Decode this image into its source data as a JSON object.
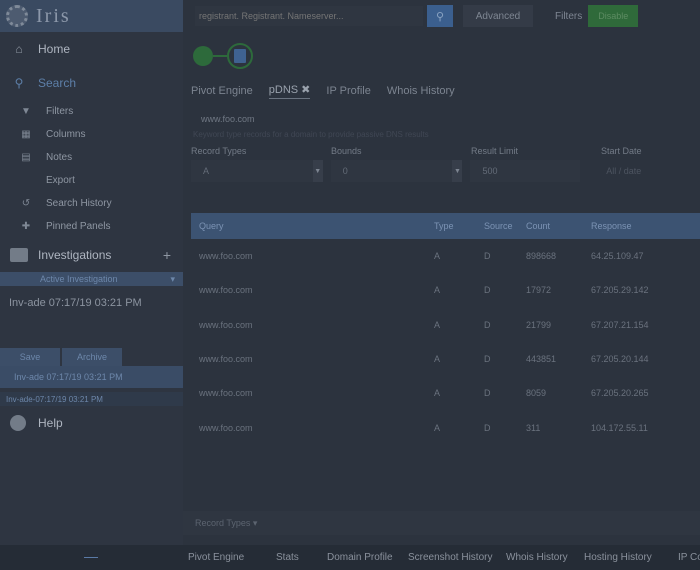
{
  "app": {
    "logo_text": "Iris"
  },
  "sidebar": {
    "main_items": [
      {
        "label": "Home",
        "icon": "home-icon"
      },
      {
        "label": "Search",
        "icon": "search-icon"
      }
    ],
    "search_sub_items": [
      {
        "label": "Filters",
        "icon": "filter-icon"
      },
      {
        "label": "Columns",
        "icon": "columns-icon"
      },
      {
        "label": "Notes",
        "icon": "notes-icon"
      },
      {
        "label": "Export",
        "icon": ""
      },
      {
        "label": "Search History",
        "icon": "history-icon"
      },
      {
        "label": "Pinned Panels",
        "icon": "pin-icon"
      }
    ],
    "investigations_label": "Investigations",
    "active_investigation": "Active Investigation",
    "investigation_title": "Inv-ade 07:17/19 03:21 PM",
    "tabs": [
      "Save",
      "Archive"
    ],
    "selected_item": "Inv-ade 07:17/19 03:21 PM",
    "investigation_item": "Inv-ade-07:17/19 03:21 PM",
    "help_label": "Help"
  },
  "topbar": {
    "search_placeholder": "registrant. Registrant. Nameserver...",
    "advanced_label": "Advanced",
    "filters_label": "Filters",
    "filters_button": "Disable"
  },
  "tabs": [
    "Pivot Engine",
    "pDNS",
    "IP Profile",
    "Whois History"
  ],
  "active_tab": "pDNS",
  "query_value": "www.foo.com",
  "hint_text": "Keyword type records for a domain to provide passive DNS results",
  "form": {
    "labels": [
      "Record Types",
      "Bounds",
      "Result Limit",
      "Start Date"
    ],
    "record_type": "A",
    "bounds": "0",
    "result_limit": "500",
    "start_date": "All / date"
  },
  "table": {
    "headers": [
      "Query",
      "Type",
      "Source",
      "Count",
      "Response"
    ],
    "rows": [
      [
        "www.foo.com",
        "A",
        "D",
        "898668",
        "64.25.109.47"
      ],
      [
        "www.foo.com",
        "A",
        "D",
        "17972",
        "67.205.29.142"
      ],
      [
        "www.foo.com",
        "A",
        "D",
        "21799",
        "67.207.21.154"
      ],
      [
        "www.foo.com",
        "A",
        "D",
        "443851",
        "67.205.20.144"
      ],
      [
        "www.foo.com",
        "A",
        "D",
        "8059",
        "67.205.20.265"
      ],
      [
        "www.foo.com",
        "A",
        "D",
        "311",
        "104.172.55.11"
      ]
    ]
  },
  "footer_text": "Record Types",
  "bottom_tabs": [
    "Pivot Engine",
    "Stats",
    "Domain Profile",
    "Screenshot History",
    "Whois History",
    "Hosting History",
    "IP Co"
  ]
}
